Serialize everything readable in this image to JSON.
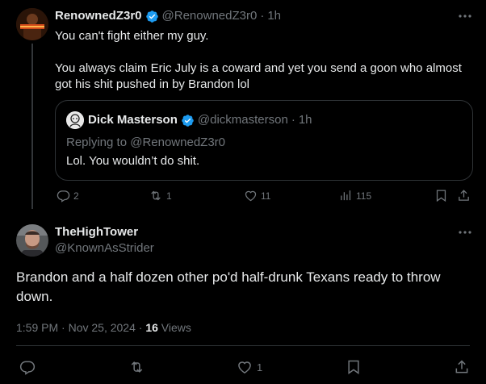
{
  "reply_context": {
    "display_name": "RenownedZ3r0",
    "handle": "@RenownedZ3r0",
    "sep": "·",
    "time": "1h",
    "line1": "You can't fight either my guy.",
    "line2": "You always claim Eric July is a coward and yet you send a goon who almost got his shit pushed in by Brandon lol",
    "quote": {
      "display_name": "Dick Masterson",
      "handle": "@dickmasterson",
      "sep": "·",
      "time": "1h",
      "replying_to": "Replying to @RenownedZ3r0",
      "text": "Lol. You wouldn’t do shit."
    },
    "actions": {
      "replies": "2",
      "reposts": "1",
      "likes": "11",
      "views": "115"
    }
  },
  "main_post": {
    "display_name": "TheHighTower",
    "handle": "@KnownAsStrider",
    "text": "Brandon and a half dozen other po'd half-drunk Texans ready to throw down.",
    "timestamp": "1:59 PM · Nov 25, 2024 · ",
    "views_count": "16",
    "views_label": " Views",
    "actions": {
      "likes": "1"
    }
  },
  "colors": {
    "background": "#000000",
    "text": "#e7e9ea",
    "muted": "#71767b",
    "verified": "#1d9bf0",
    "divider": "#2f3336"
  }
}
